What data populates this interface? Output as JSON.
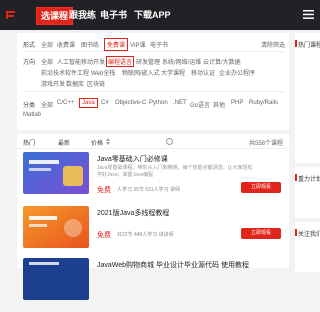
{
  "top_nav": {
    "tabs": [
      {
        "label": "选课程",
        "active": true
      },
      {
        "label": "跟我练",
        "active": false
      },
      {
        "label": "电子书",
        "active": false
      },
      {
        "label": "下载APP",
        "active": false
      }
    ]
  },
  "filters": {
    "form": {
      "label": "形式",
      "options": [
        "全部",
        "收费课",
        "图书练",
        "免费课",
        "VIP课",
        "电子书"
      ],
      "selected": "免费课",
      "clear_label": "清除筛选"
    },
    "direction": {
      "label": "方向",
      "options": [
        "全部",
        "人工智能",
        "移动开发",
        "编程语言",
        "研发管理",
        "系统/网络/运维",
        "云计算/大数据"
      ],
      "options_row2": [
        "前沿技术",
        "软件工程",
        "Web全栈",
        "物联网/嵌入式",
        "大学课程",
        "移动认证",
        "企业办公程序"
      ],
      "options_row3": [
        "游戏开发",
        "数据库",
        "区块链"
      ],
      "selected": "编程语言"
    },
    "category": {
      "label": "分类",
      "options": [
        "全部",
        "C/C++",
        "Java",
        "C#",
        "Objective-C",
        "Python",
        ".NET",
        "Go语言",
        "其他",
        "PHP",
        "Ruby/Rails"
      ],
      "options_row2": [
        "Matlab"
      ],
      "selected": "Java"
    }
  },
  "sort_bar": {
    "options": [
      "热门",
      "最新",
      "价格"
    ],
    "selected": "热门",
    "total_text": "共558个课程"
  },
  "courses": [
    {
      "title": "Java零基础入门必修课",
      "desc": "Java零基础课程，带你从入门到精通，每个技能点都讲透，让大家轻松学好Java；掌握Java编程",
      "price": "免费",
      "meta": "人学习 35节 631人学习  讲师",
      "button": "立即观看"
    },
    {
      "title": "2021版Java多线程教程",
      "desc": "",
      "price": "免费",
      "meta": "共22节  446人学习  讲讲师",
      "button": "立即观看"
    },
    {
      "title": "JavaWeb购物商城 毕业设计毕业源代码 使用教程",
      "desc": "",
      "price": "",
      "meta": "",
      "button": ""
    }
  ],
  "sidebar": {
    "sections": [
      "热门课程",
      "重力计划",
      "关注我们"
    ]
  },
  "colors": {
    "accent": "#e1251b",
    "topnav_bg": "#202226",
    "page_bg": "#f3f3f3"
  },
  "icons": {
    "logo": "brand-logo-icon",
    "menu": "hamburger-menu-icon"
  }
}
